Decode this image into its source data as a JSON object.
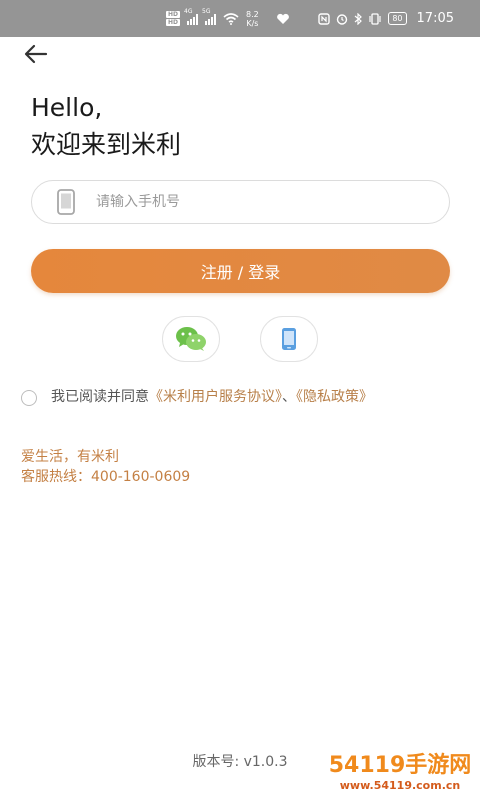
{
  "status_bar": {
    "hd1": "HD",
    "hd2": "HD",
    "net1": "4G",
    "net2": "5G",
    "speed_value": "8.2",
    "speed_unit": "K/s",
    "battery": "80",
    "time": "17:05"
  },
  "greeting": {
    "line1": "Hello,",
    "line2": "欢迎来到米利"
  },
  "phone_input": {
    "placeholder": "请输入手机号",
    "value": ""
  },
  "login_button": {
    "label": "注册 / 登录"
  },
  "alt_login": {
    "wechat_icon": "wechat-icon",
    "phone_icon": "smartphone-icon"
  },
  "agreement": {
    "prefix": "我已阅读并同意",
    "user_agreement": "《米利用户服务协议》",
    "separator": "、",
    "privacy_policy": "《隐私政策》",
    "checked": false
  },
  "footer_info": {
    "slogan": "爱生活，有米利",
    "hotline_label": "客服热线：",
    "hotline_number": "400-160-0609"
  },
  "version": "版本号: v1.0.3",
  "watermark": {
    "main": "54119手游网",
    "sub": "www.54119.com.cn"
  },
  "colors": {
    "accent": "#e5873c",
    "link": "#b8804a",
    "status_bar": "#959595"
  }
}
